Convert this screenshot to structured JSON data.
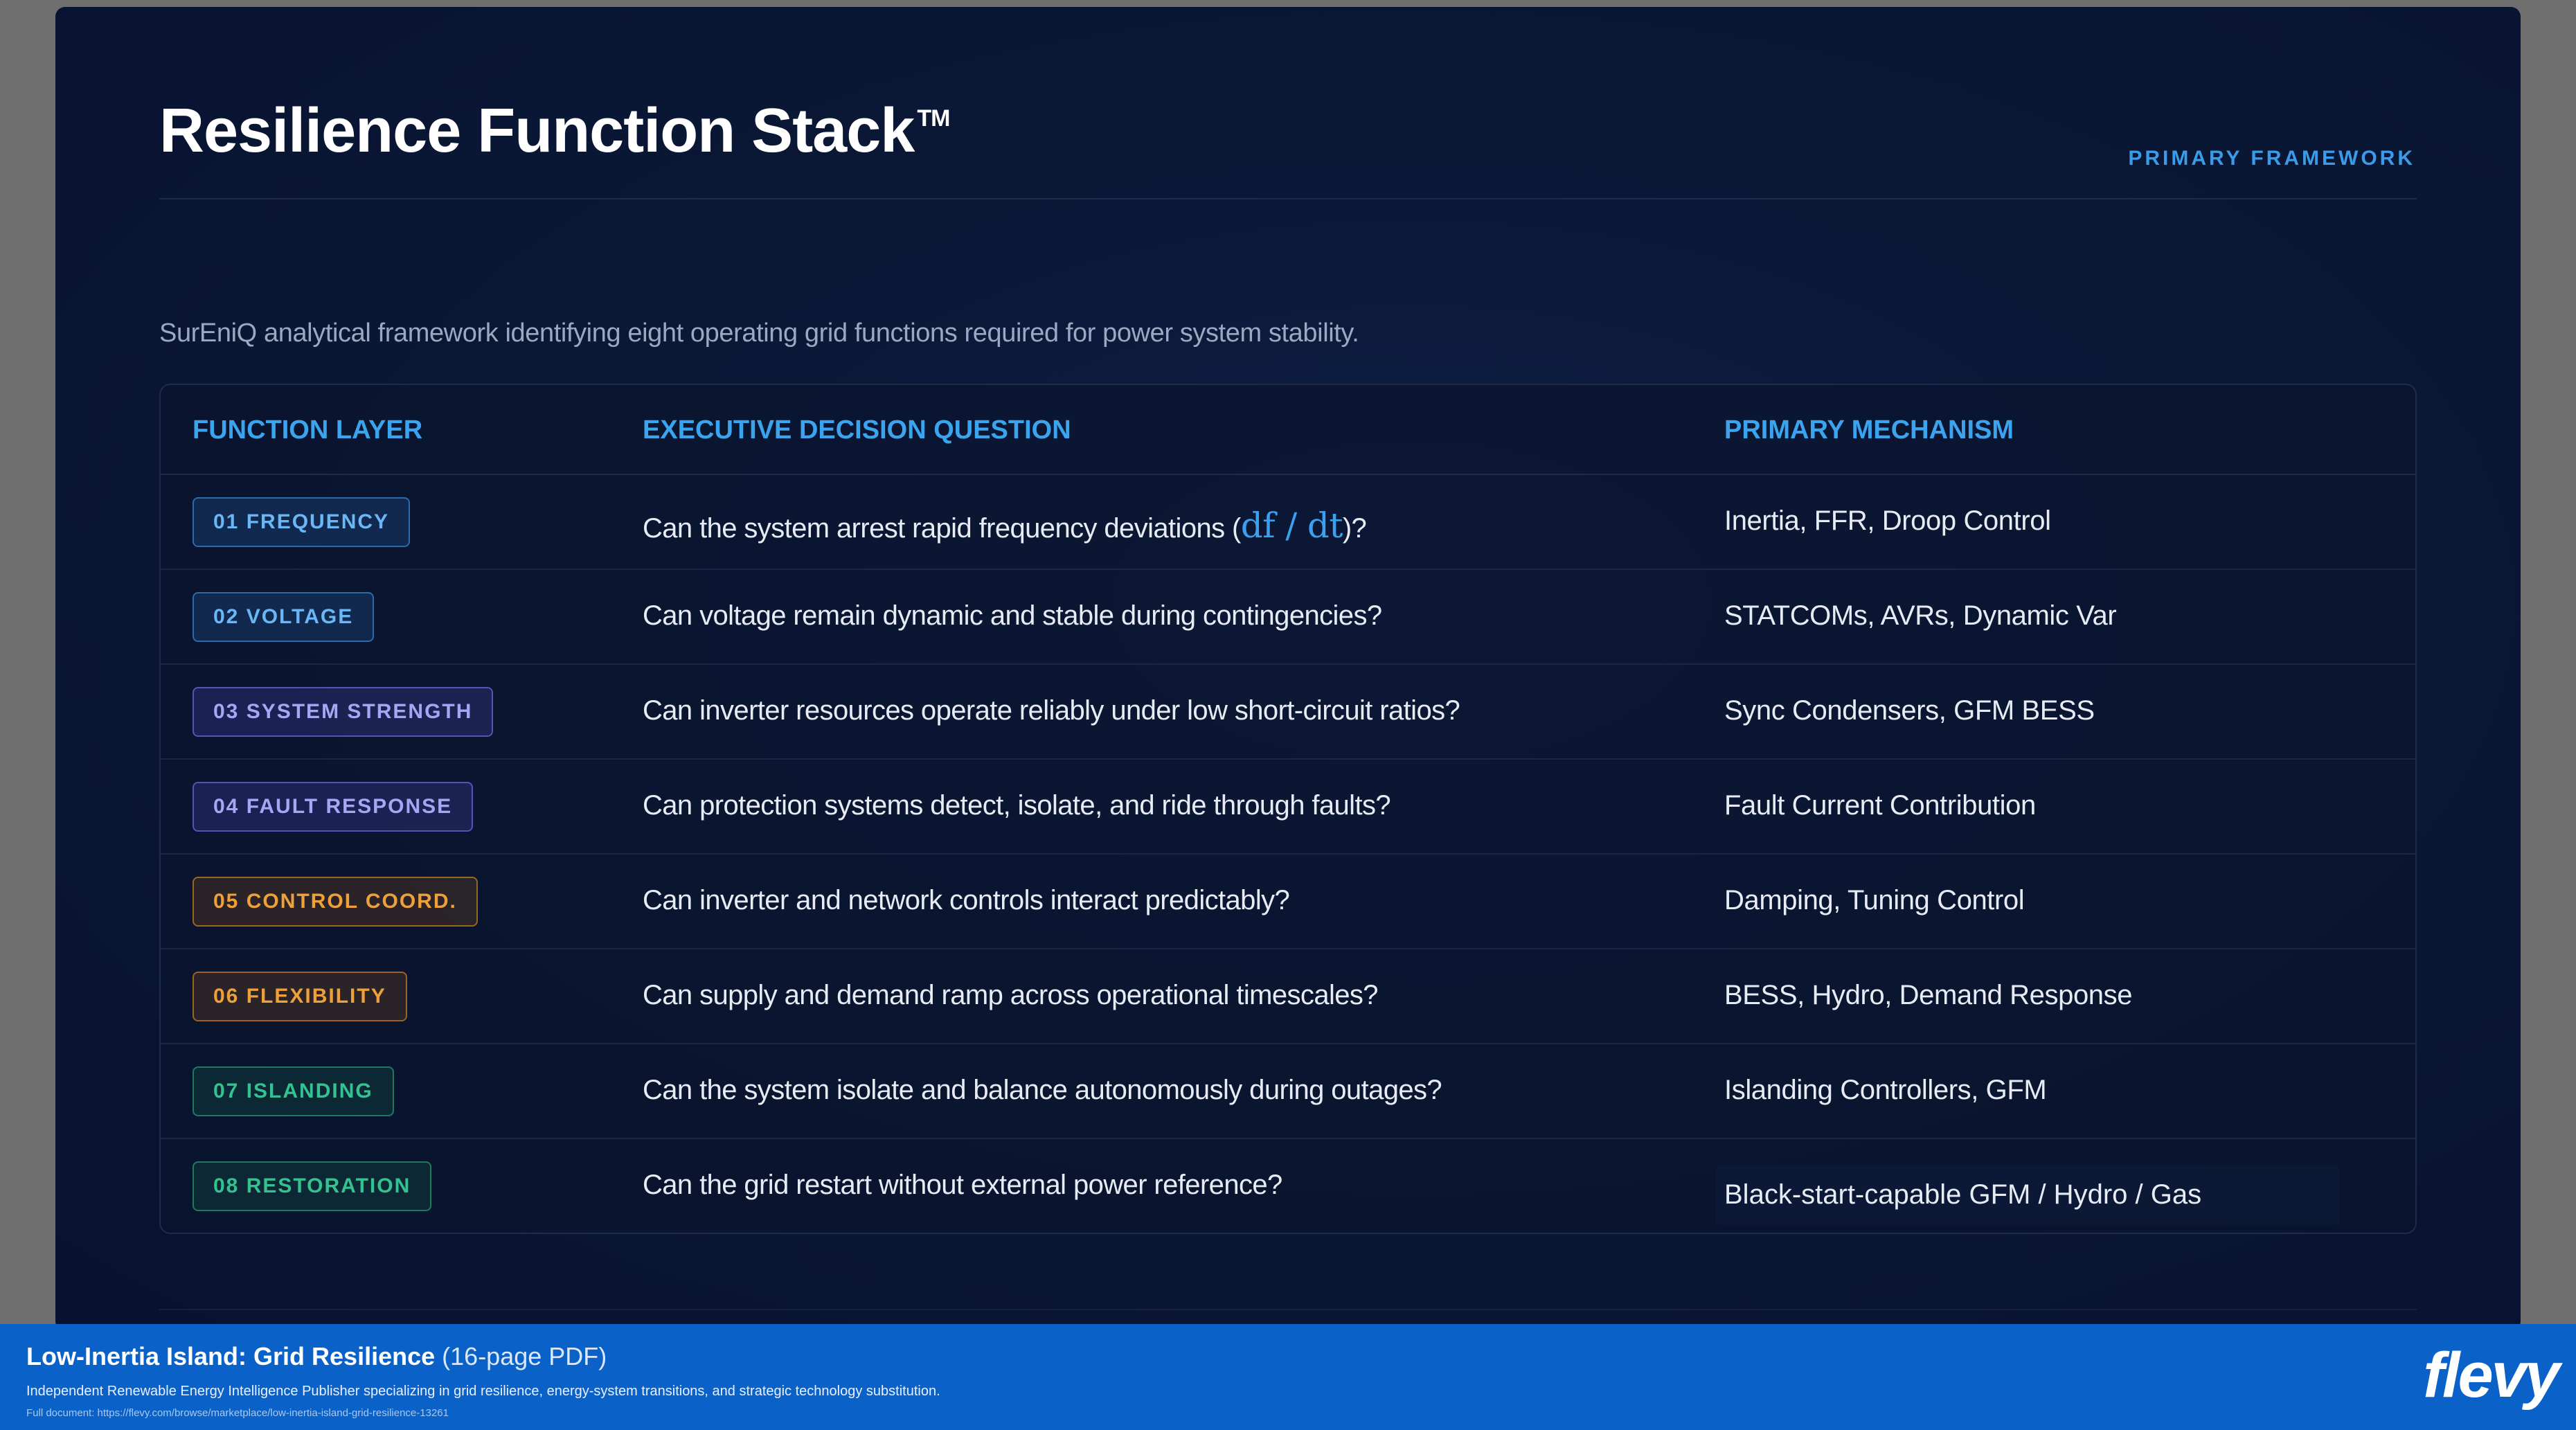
{
  "slide": {
    "title": "Resilience Function Stack",
    "trademark": "TM",
    "tag": "PRIMARY FRAMEWORK",
    "subtitle": "SurEniQ analytical framework identifying eight operating grid functions required for power system stability."
  },
  "table": {
    "headers": [
      "FUNCTION LAYER",
      "EXECUTIVE DECISION QUESTION",
      "PRIMARY MECHANISM"
    ],
    "rows": [
      {
        "badge": "01 FREQUENCY",
        "question_prefix": "Can the system arrest rapid frequency deviations (",
        "formula": "df / dt",
        "question_suffix": ")?",
        "mechanism": "Inertia, FFR, Droop Control",
        "badge_color": "blue"
      },
      {
        "badge": "02 VOLTAGE",
        "question": "Can voltage remain dynamic and stable during contingencies?",
        "mechanism": "STATCOMs, AVRs, Dynamic Var",
        "badge_color": "blue"
      },
      {
        "badge": "03 SYSTEM STRENGTH",
        "question": "Can inverter resources operate reliably under low short-circuit ratios?",
        "mechanism": "Sync Condensers, GFM BESS",
        "badge_color": "purple"
      },
      {
        "badge": "04 FAULT RESPONSE",
        "question": "Can protection systems detect, isolate, and ride through faults?",
        "mechanism": "Fault Current Contribution",
        "badge_color": "purple"
      },
      {
        "badge": "05 CONTROL COORD.",
        "question": "Can inverter and network controls interact predictably?",
        "mechanism": "Damping, Tuning Control",
        "badge_color": "orange"
      },
      {
        "badge": "06 FLEXIBILITY",
        "question": "Can supply and demand ramp across operational timescales?",
        "mechanism": "BESS, Hydro, Demand Response",
        "badge_color": "orange"
      },
      {
        "badge": "07 ISLANDING",
        "question": "Can the system isolate and balance autonomously during outages?",
        "mechanism": "Islanding Controllers, GFM",
        "badge_color": "green"
      },
      {
        "badge": "08 RESTORATION",
        "question": "Can the grid restart without external power reference?",
        "mechanism": "Black-start-capable GFM / Hydro / Gas",
        "badge_color": "green"
      }
    ]
  },
  "footer": {
    "title": "Low-Inertia Island: Grid Resilience",
    "pages": "(16-page PDF)",
    "description": "Independent Renewable Energy Intelligence Publisher specializing in grid resilience, energy-system transitions, and strategic technology substitution.",
    "link": "Full document: https://flevy.com/browse/marketplace/low-inertia-island-grid-resilience-13261",
    "logo": "flevy"
  },
  "colors": {
    "accent": "#3ba4ee",
    "background": "#0a1836",
    "footer": "#0a62c8"
  }
}
